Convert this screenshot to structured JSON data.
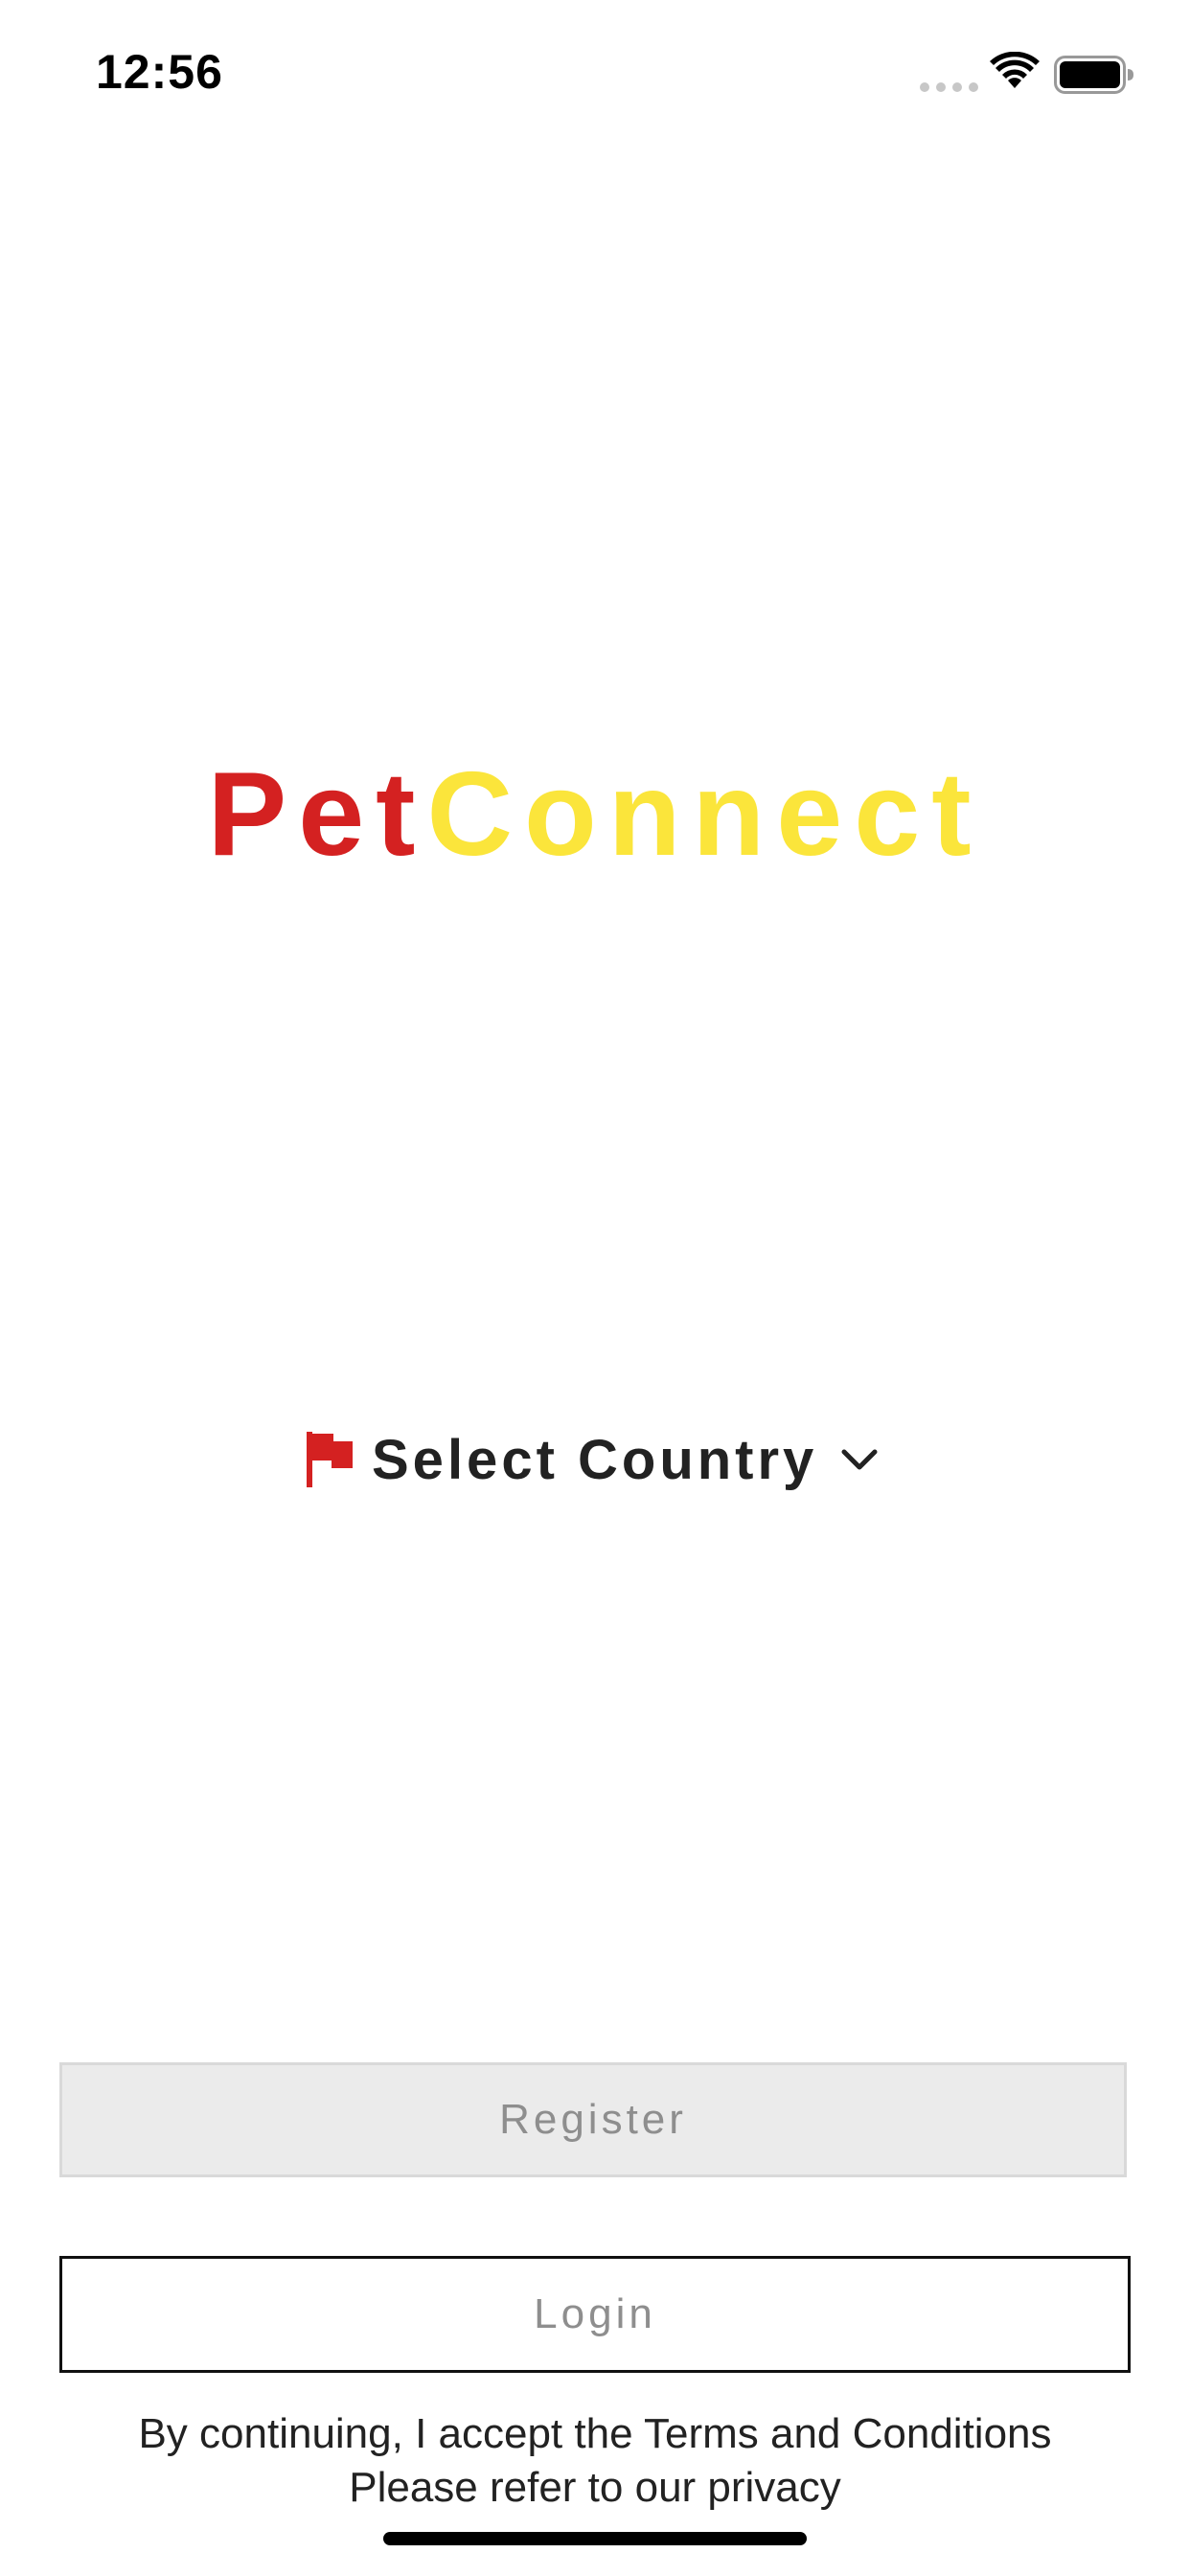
{
  "status_bar": {
    "time": "12:56",
    "icons": [
      "cellular-signal-icon",
      "wifi-icon",
      "battery-icon"
    ]
  },
  "logo": {
    "part1": "Pet",
    "part2": "Connect",
    "part1_color": "#d42121",
    "part2_color": "#fbe53b"
  },
  "country_selector": {
    "label": "Select Country",
    "icon": "flag-icon",
    "flag_color": "#d42121",
    "chevron": "chevron-down-icon"
  },
  "buttons": {
    "register_label": "Register",
    "login_label": "Login"
  },
  "legal": {
    "line1": "By continuing, I accept the Terms and Conditions",
    "line2": "Please refer to our privacy"
  }
}
